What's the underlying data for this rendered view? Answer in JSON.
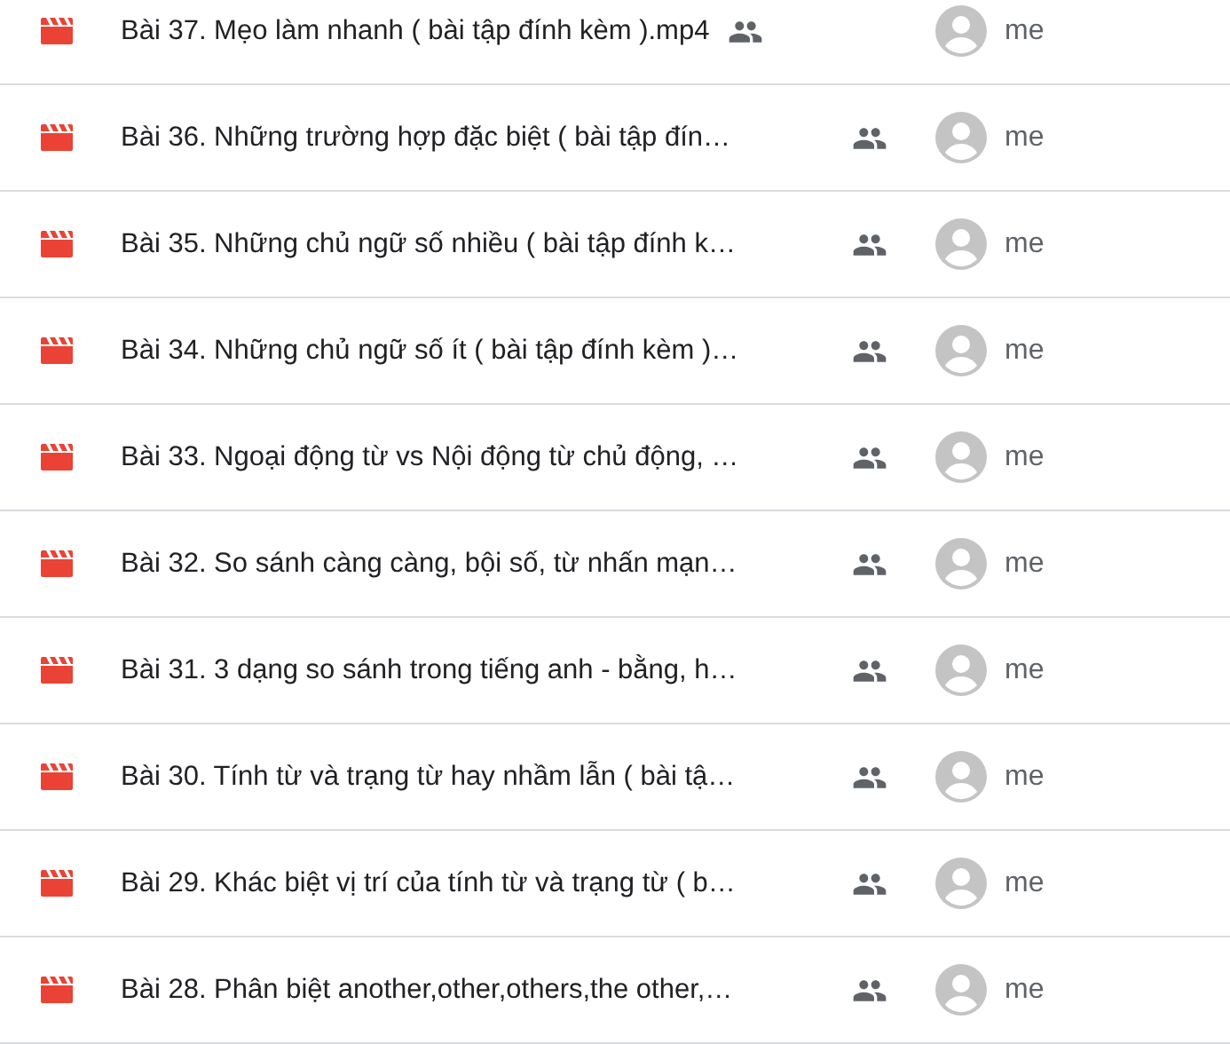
{
  "files": [
    {
      "name": "Bài 37. Mẹo làm nhanh ( bài tập đính kèm ).mp4",
      "shared": true,
      "owner": "me"
    },
    {
      "name": "Bài 36. Những trường hợp đặc biệt ( bài tập đín…",
      "shared": true,
      "owner": "me"
    },
    {
      "name": "Bài 35. Những chủ ngữ số nhiều ( bài tập đính k…",
      "shared": true,
      "owner": "me"
    },
    {
      "name": "Bài 34. Những chủ ngữ số ít ( bài tập đính kèm )…",
      "shared": true,
      "owner": "me"
    },
    {
      "name": "Bài 33. Ngoại động từ vs Nội động từ chủ động, …",
      "shared": true,
      "owner": "me"
    },
    {
      "name": "Bài 32. So sánh càng càng, bội số, từ nhấn mạn…",
      "shared": true,
      "owner": "me"
    },
    {
      "name": "Bài 31. 3 dạng so sánh trong tiếng anh - bằng, h…",
      "shared": true,
      "owner": "me"
    },
    {
      "name": "Bài 30. Tính từ và trạng từ hay nhầm lẫn ( bài tậ…",
      "shared": true,
      "owner": "me"
    },
    {
      "name": "Bài 29. Khác biệt vị trí của tính từ và trạng từ ( b…",
      "shared": true,
      "owner": "me"
    },
    {
      "name": "Bài 28. Phân biệt another,other,others,the other,…",
      "shared": true,
      "owner": "me"
    }
  ]
}
